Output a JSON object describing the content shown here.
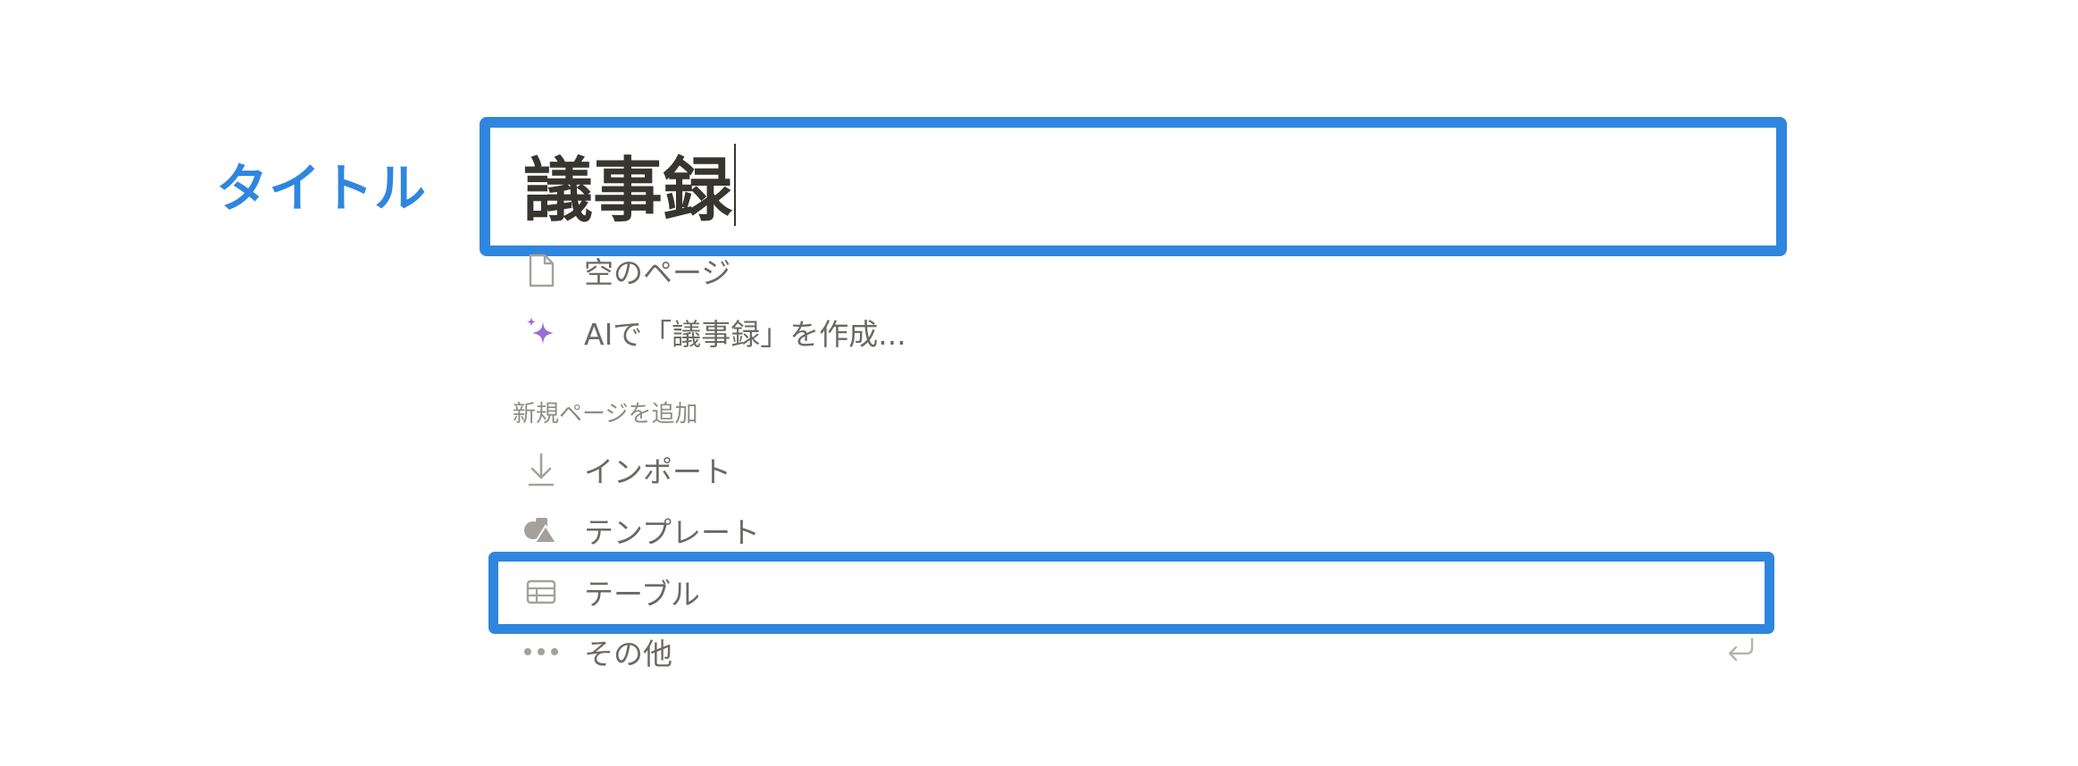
{
  "callout": {
    "label": "タイトル"
  },
  "title_field": {
    "value": "議事録"
  },
  "suggestions": [
    {
      "icon": "page-icon",
      "label": "空のページ"
    },
    {
      "icon": "ai-sparkle-icon",
      "label": "AIで「議事録」を作成..."
    }
  ],
  "new_page_section": {
    "heading": "新規ページを追加",
    "items": [
      {
        "icon": "import-arrow-icon",
        "label": "インポート"
      },
      {
        "icon": "template-shapes-icon",
        "label": "テンプレート"
      },
      {
        "icon": "table-icon",
        "label": "テーブル"
      },
      {
        "icon": "more-dots-icon",
        "label": "その他"
      }
    ]
  },
  "colors": {
    "highlight": "#2f86de",
    "title_text": "#37352f",
    "menu_text": "#6b6966",
    "section_text": "#8e8b86",
    "icon_gray": "#a4a19c",
    "sparkle_purple": "#9a6dd7"
  }
}
